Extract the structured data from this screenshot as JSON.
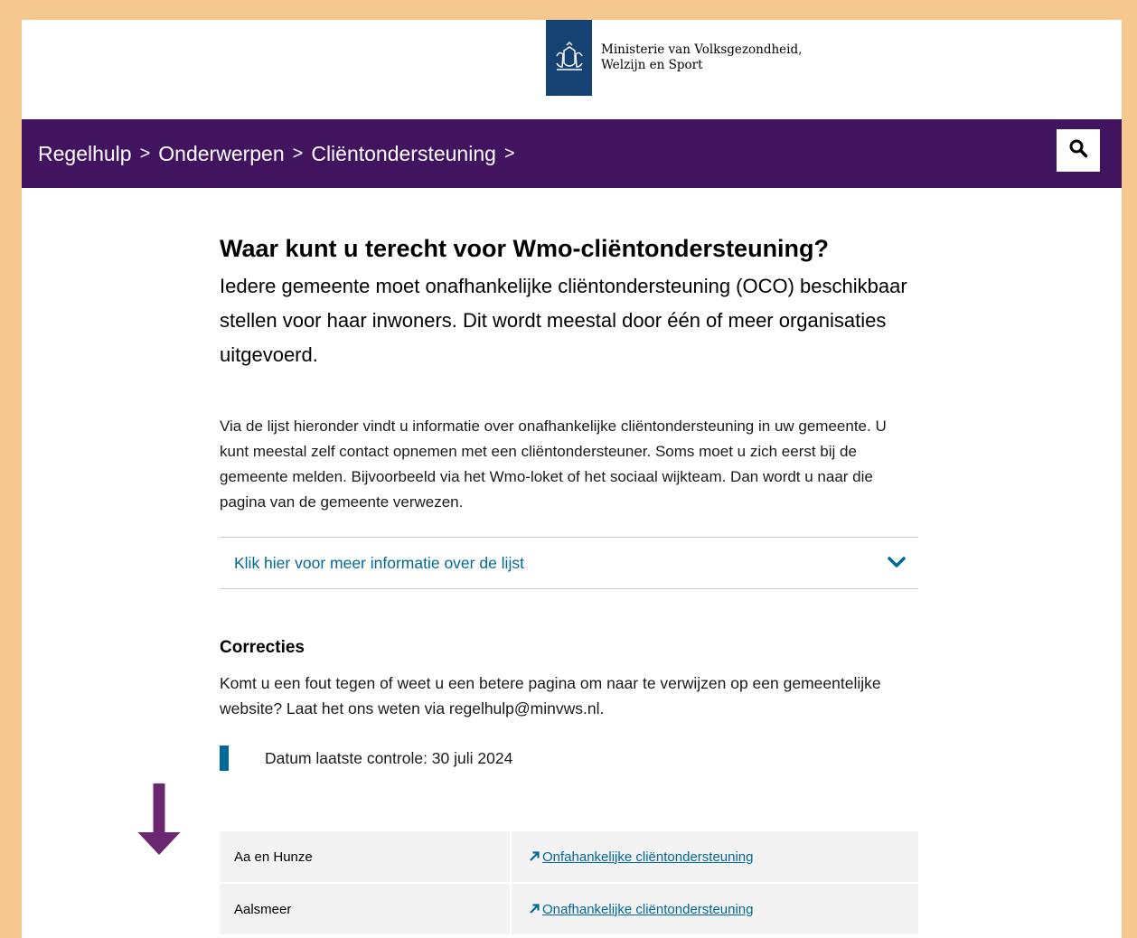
{
  "header": {
    "ministry_line1": "Ministerie van Volksgezondheid,",
    "ministry_line2": "Welzijn en Sport"
  },
  "breadcrumb": {
    "items": [
      "Regelhulp",
      "Onderwerpen",
      "Cliëntondersteuning"
    ],
    "separator": ">"
  },
  "main": {
    "title": "Waar kunt u terecht voor Wmo-cliëntondersteuning?",
    "intro": "Iedere gemeente moet onafhankelijke cliëntondersteuning (OCO) beschikbaar stellen voor haar inwoners. Dit wordt meestal door één of meer organisaties uitgevoerd.",
    "body": "Via de lijst hieronder vindt u informatie over onafhankelijke cliëntondersteuning in uw gemeente. U kunt meestal zelf contact opnemen met een cliëntondersteuner. Soms moet u zich eerst bij de gemeente melden. Bijvoorbeeld via het Wmo-loket of het sociaal wijkteam. Dan wordt u naar die pagina van de gemeente verwezen.",
    "accordion_label": "Klik hier voor meer informatie over de lijst",
    "corrections_title": "Correcties",
    "corrections_text": "Komt u een fout tegen of weet u een betere pagina om naar te verwijzen op een gemeentelijke website? Laat het ons weten via regelhulp@minvws.nl.",
    "date_check": "Datum laatste controle: 30 juli 2024"
  },
  "table": {
    "rows": [
      {
        "name": "Aa en Hunze",
        "link": "Onfahankelijke cliëntondersteuning"
      },
      {
        "name": "Aalsmeer",
        "link": "Onafhankelijke cliëntondersteuning"
      }
    ]
  },
  "colors": {
    "nav_bg": "#42145f",
    "logo_bg": "#154273",
    "link": "#01689b",
    "border": "#f5c88f",
    "arrow": "#6b2770"
  }
}
